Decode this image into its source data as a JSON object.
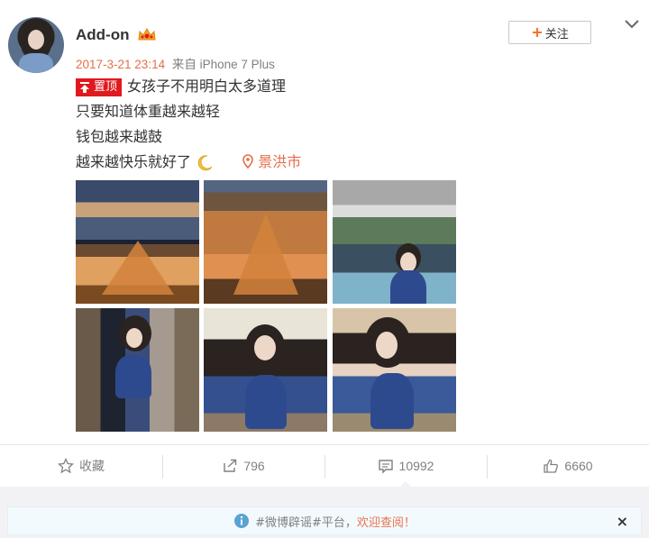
{
  "post": {
    "username": "Add-on",
    "timestamp": "2017-3-21 23:14",
    "source": "来自 iPhone 7 Plus",
    "follow_label": "关注",
    "pin_label": "置顶",
    "lines": [
      "女孩子不用明白太多道理",
      "只要知道体重越来越轻",
      "钱包越来越鼓",
      "越来越快乐就好了"
    ],
    "location": "景洪市",
    "photo_count": 6
  },
  "actions": {
    "favorite_label": "收藏",
    "repost_count": "796",
    "comment_count": "10992",
    "like_count": "6660"
  },
  "notice": {
    "tag_text": "#微博辟谣#平台，",
    "link_text": "欢迎查阅！",
    "close": "×"
  },
  "colors": {
    "accent_orange": "#e46f4a",
    "pin_red": "#e0191e",
    "follow_plus": "#f26d21",
    "notice_bg": "#f3fafe",
    "page_bg": "#f2f2f5"
  },
  "icons": {
    "vip": "vip-crown-icon",
    "chevron": "chevron-down-icon",
    "pin": "pin-top-icon",
    "moon": "crescent-moon-icon",
    "location": "location-pin-icon",
    "favorite": "star-icon",
    "repost": "repost-icon",
    "comment": "comment-icon",
    "like": "thumbs-up-icon",
    "info": "info-icon"
  }
}
